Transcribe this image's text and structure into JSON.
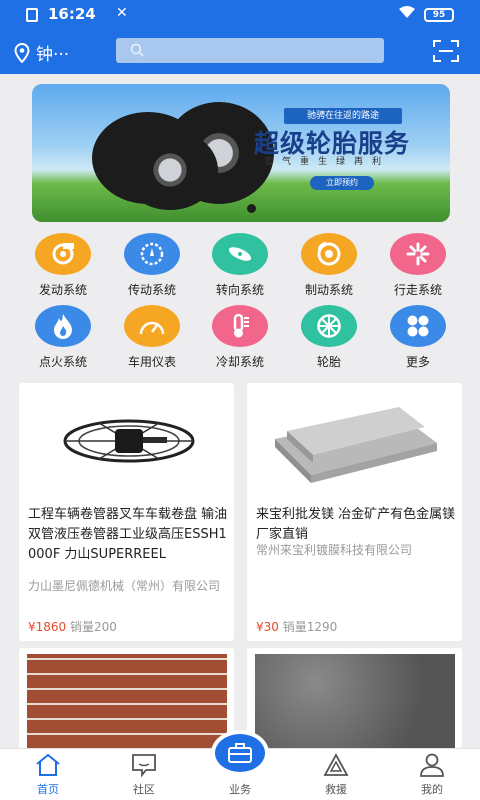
{
  "status": {
    "time": "16:24",
    "battery": "95"
  },
  "header": {
    "location": "钟···",
    "search_placeholder": ""
  },
  "banner": {
    "subtitle": "驰骋在往返的路途",
    "title": "超级轮胎服务",
    "line": "蓄气重生绿再利",
    "button": "立即预约"
  },
  "categories": [
    {
      "label": "发动系统",
      "icon": "turbo-icon",
      "color": "#f5a623"
    },
    {
      "label": "传动系统",
      "icon": "gear-shift-icon",
      "color": "#3b8ae8"
    },
    {
      "label": "转向系统",
      "icon": "steering-icon",
      "color": "#2fc1a0"
    },
    {
      "label": "制动系统",
      "icon": "brake-icon",
      "color": "#f5a623"
    },
    {
      "label": "行走系统",
      "icon": "wheel-spin-icon",
      "color": "#f2668b"
    },
    {
      "label": "点火系统",
      "icon": "flame-icon",
      "color": "#3b8ae8"
    },
    {
      "label": "车用仪表",
      "icon": "gauge-icon",
      "color": "#f5a623"
    },
    {
      "label": "冷却系统",
      "icon": "thermometer-icon",
      "color": "#f2668b"
    },
    {
      "label": "轮胎",
      "icon": "tire-icon",
      "color": "#2fc1a0"
    },
    {
      "label": "更多",
      "icon": "more-grid-icon",
      "color": "#3b8ae8"
    }
  ],
  "products": [
    {
      "title": "工程车辆卷管器叉车车载卷盘 输油双管液压卷管器工业级高压ESSH1000F 力山SUPERREEL",
      "shop": "力山墨尼佩德机械（常州）有限公司",
      "price": "¥1860",
      "sales": "销量200"
    },
    {
      "title": "来宝利批发镁 冶金矿产有色金属镁 厂家直销",
      "shop": "常州来宝利镀膜科技有限公司",
      "price": "¥30",
      "sales": "销量1290"
    }
  ],
  "tabs": [
    {
      "label": "首页",
      "icon": "home-icon"
    },
    {
      "label": "社区",
      "icon": "chat-icon"
    },
    {
      "label": "业务",
      "icon": "briefcase-icon"
    },
    {
      "label": "救援",
      "icon": "warning-triangle-icon"
    },
    {
      "label": "我的",
      "icon": "person-icon"
    }
  ]
}
